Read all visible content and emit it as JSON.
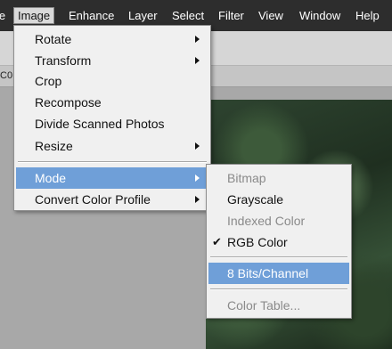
{
  "menubar": {
    "items": [
      {
        "label": "le"
      },
      {
        "label": "Image"
      },
      {
        "label": "Enhance"
      },
      {
        "label": "Layer"
      },
      {
        "label": "Select"
      },
      {
        "label": "Filter"
      },
      {
        "label": "View"
      },
      {
        "label": "Window"
      },
      {
        "label": "Help"
      }
    ],
    "active": "Image"
  },
  "panel_strip": {
    "tab_text": "C0"
  },
  "image_menu": {
    "items": [
      {
        "label": "Rotate",
        "submenu": true
      },
      {
        "label": "Transform",
        "submenu": true
      },
      {
        "label": "Crop",
        "submenu": false
      },
      {
        "label": "Recompose",
        "submenu": false
      },
      {
        "label": "Divide Scanned Photos",
        "submenu": false
      },
      {
        "label": "Resize",
        "submenu": true
      },
      {
        "label": "Mode",
        "submenu": true,
        "highlighted": true
      },
      {
        "label": "Convert Color Profile",
        "submenu": true
      }
    ]
  },
  "mode_submenu": {
    "items": [
      {
        "label": "Bitmap",
        "enabled": false
      },
      {
        "label": "Grayscale",
        "enabled": true
      },
      {
        "label": "Indexed Color",
        "enabled": false
      },
      {
        "label": "RGB Color",
        "enabled": true,
        "checked": true
      },
      {
        "label": "8 Bits/Channel",
        "enabled": true,
        "highlighted": true
      },
      {
        "label": "Color Table...",
        "enabled": false
      }
    ],
    "check_glyph": "✔"
  },
  "colors": {
    "menubar_bg": "#2d2d2d",
    "highlight": "#6f9fd8",
    "menu_bg": "#f0f0f0",
    "disabled_text": "#8a8a8a"
  }
}
